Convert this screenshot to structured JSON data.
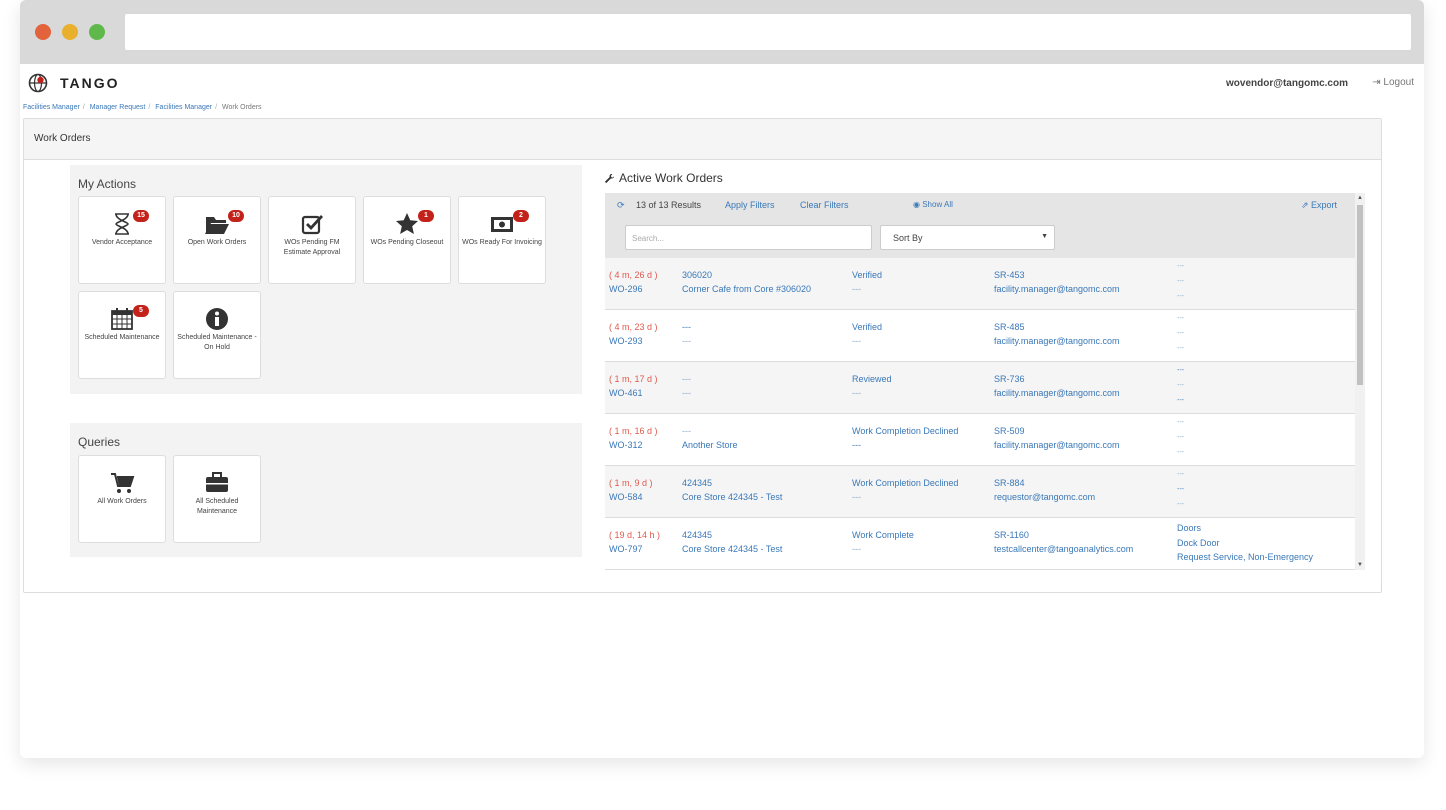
{
  "app": {
    "brand": "TANGO",
    "user_email": "wovendor@tangomc.com",
    "logout_label": "Logout"
  },
  "breadcrumbs": [
    "Facilities Manager",
    "Manager Request",
    "Facilities Manager",
    "Work Orders"
  ],
  "panel_title": "Work Orders",
  "my_actions": {
    "title": "My Actions",
    "tiles": [
      {
        "label": "Vendor Acceptance",
        "badge": "15",
        "icon": "hourglass-icon"
      },
      {
        "label": "Open Work Orders",
        "badge": "10",
        "icon": "folder-open-icon"
      },
      {
        "label": "WOs Pending FM Estimate Approval",
        "badge": "",
        "icon": "check-square-icon"
      },
      {
        "label": "WOs Pending Closeout",
        "badge": "1",
        "icon": "star-icon"
      },
      {
        "label": "WOs Ready For Invoicing",
        "badge": "2",
        "icon": "money-icon"
      },
      {
        "label": "Scheduled Maintenance",
        "badge": "5",
        "icon": "calendar-icon"
      },
      {
        "label": "Scheduled Maintenance - On Hold",
        "badge": "",
        "icon": "info-icon"
      }
    ]
  },
  "queries": {
    "title": "Queries",
    "tiles": [
      {
        "label": "All Work Orders",
        "icon": "cart-icon"
      },
      {
        "label": "All Scheduled Maintenance",
        "icon": "briefcase-icon"
      }
    ]
  },
  "active_work_orders": {
    "title": "Active Work Orders",
    "results": "13 of 13 Results",
    "apply_filters": "Apply Filters",
    "clear_filters": "Clear Filters",
    "show_all": "Show All",
    "export": "Export",
    "search_placeholder": "Search...",
    "sort_label": "Sort By",
    "rows": [
      {
        "age": "( 4 m, 26 d )",
        "wo": "WO-296",
        "code": "306020",
        "store": "Corner Cafe from Core #306020",
        "status": "Verified",
        "status2": "---",
        "sr": "SR-453",
        "email": "facility.manager@tangomc.com",
        "extra": [
          "---",
          "---",
          "---"
        ]
      },
      {
        "age": "( 4 m, 23 d )",
        "wo": "WO-293",
        "code": "---",
        "store": "---",
        "status": "Verified",
        "status2": "---",
        "sr": "SR-485",
        "email": "facility.manager@tangomc.com",
        "extra": [
          "---",
          "---",
          "---"
        ]
      },
      {
        "age": "( 1 m, 17 d )",
        "wo": "WO-461",
        "code": "---",
        "store": "---",
        "status": "Reviewed",
        "status2": "---",
        "sr": "SR-736",
        "email": "facility.manager@tangomc.com",
        "extra": [
          "---",
          "---",
          "---"
        ]
      },
      {
        "age": "( 1 m, 16 d )",
        "wo": "WO-312",
        "code": "---",
        "store": "Another Store",
        "status": "Work Completion Declined",
        "status2": "---",
        "sr": "SR-509",
        "email": "facility.manager@tangomc.com",
        "extra": [
          "---",
          "---",
          "---"
        ]
      },
      {
        "age": "( 1 m, 9 d )",
        "wo": "WO-584",
        "code": "424345",
        "store": "Core Store 424345 - Test",
        "status": "Work Completion Declined",
        "status2": "---",
        "sr": "SR-884",
        "email": "requestor@tangomc.com",
        "extra": [
          "---",
          "---",
          "---"
        ]
      },
      {
        "age": "( 19 d, 14 h )",
        "wo": "WO-797",
        "code": "424345",
        "store": "Core Store 424345 - Test",
        "status": "Work Complete",
        "status2": "---",
        "sr": "SR-1160",
        "email": "testcallcenter@tangoanalytics.com",
        "extra": [
          "Doors",
          "Dock Door",
          "Request Service, Non-Emergency"
        ]
      }
    ]
  },
  "colors": {
    "accent": "#3a78b8",
    "age": "#e05a4f",
    "badge": "#c3221b"
  }
}
